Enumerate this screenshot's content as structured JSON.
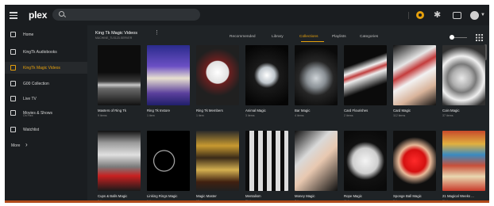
{
  "app": {
    "logo_text": "plex",
    "accent_color": "#e5a00d"
  },
  "search": {
    "placeholder": ""
  },
  "top_icons": [
    "premium-icon",
    "activity-icon",
    "cast-icon",
    "user-icon"
  ],
  "sidebar": {
    "items": [
      {
        "label": "Home",
        "sub": "",
        "icon": "home-icon",
        "active": false
      },
      {
        "label": "KingTk Audiobooks",
        "sub": "",
        "icon": "music-icon",
        "active": false
      },
      {
        "label": "KingTk Magic Videos",
        "sub": "",
        "icon": "video-icon",
        "active": true
      },
      {
        "label": "G00 Collection",
        "sub": "",
        "icon": "collection-icon",
        "active": false
      },
      {
        "label": "Live TV",
        "sub": "",
        "icon": "tv-icon",
        "active": false
      },
      {
        "label": "Movies & Shows",
        "sub": "On Plex",
        "icon": "film-icon",
        "active": false
      },
      {
        "label": "Watchlist",
        "sub": "",
        "icon": "bookmark-icon",
        "active": false
      }
    ],
    "more_label": "More"
  },
  "library": {
    "title": "King Tk Magic Videos",
    "subtitle": "MACHINE_TLS123.SERVER"
  },
  "tabs": [
    {
      "label": "Recommended",
      "active": false
    },
    {
      "label": "Library",
      "active": false
    },
    {
      "label": "Collections",
      "active": true
    },
    {
      "label": "Playlists",
      "active": false
    },
    {
      "label": "Categories",
      "active": false
    }
  ],
  "collections": [
    {
      "title": "Masters of Ring Tk",
      "count": "9 items",
      "art": "pedestal"
    },
    {
      "title": "Ring Tk Instore",
      "count": "1 item",
      "art": "tv-poster"
    },
    {
      "title": "Ring Tk Members",
      "count": "1 item",
      "art": "members"
    },
    {
      "title": "Animal Magic",
      "count": "3 items",
      "art": "animal"
    },
    {
      "title": "Bar Magic",
      "count": "4 items",
      "art": "glass"
    },
    {
      "title": "Card Flourishes",
      "count": "2 items",
      "art": "cards-row"
    },
    {
      "title": "Card Magic",
      "count": "112 items",
      "art": "cards-hand"
    },
    {
      "title": "Coin Magic",
      "count": "37 items",
      "art": "coins"
    },
    {
      "title": "Cups & Balls Magic",
      "count": "2 items",
      "art": "cups"
    },
    {
      "title": "Linking Rings Magic",
      "count": "1 item",
      "art": "rings"
    },
    {
      "title": "Magic Master",
      "count": "12 items",
      "art": "posters"
    },
    {
      "title": "Mentalism",
      "count": "21 items",
      "art": "grid"
    },
    {
      "title": "Money Magic",
      "count": "7 items",
      "art": "money"
    },
    {
      "title": "Rope Magic",
      "count": "11 items",
      "art": "rope"
    },
    {
      "title": "Sponge Ball Magic",
      "count": "3 items",
      "art": "sponge"
    },
    {
      "title": "21 Magical Weeks ...",
      "count": "21 items",
      "art": "books"
    }
  ]
}
